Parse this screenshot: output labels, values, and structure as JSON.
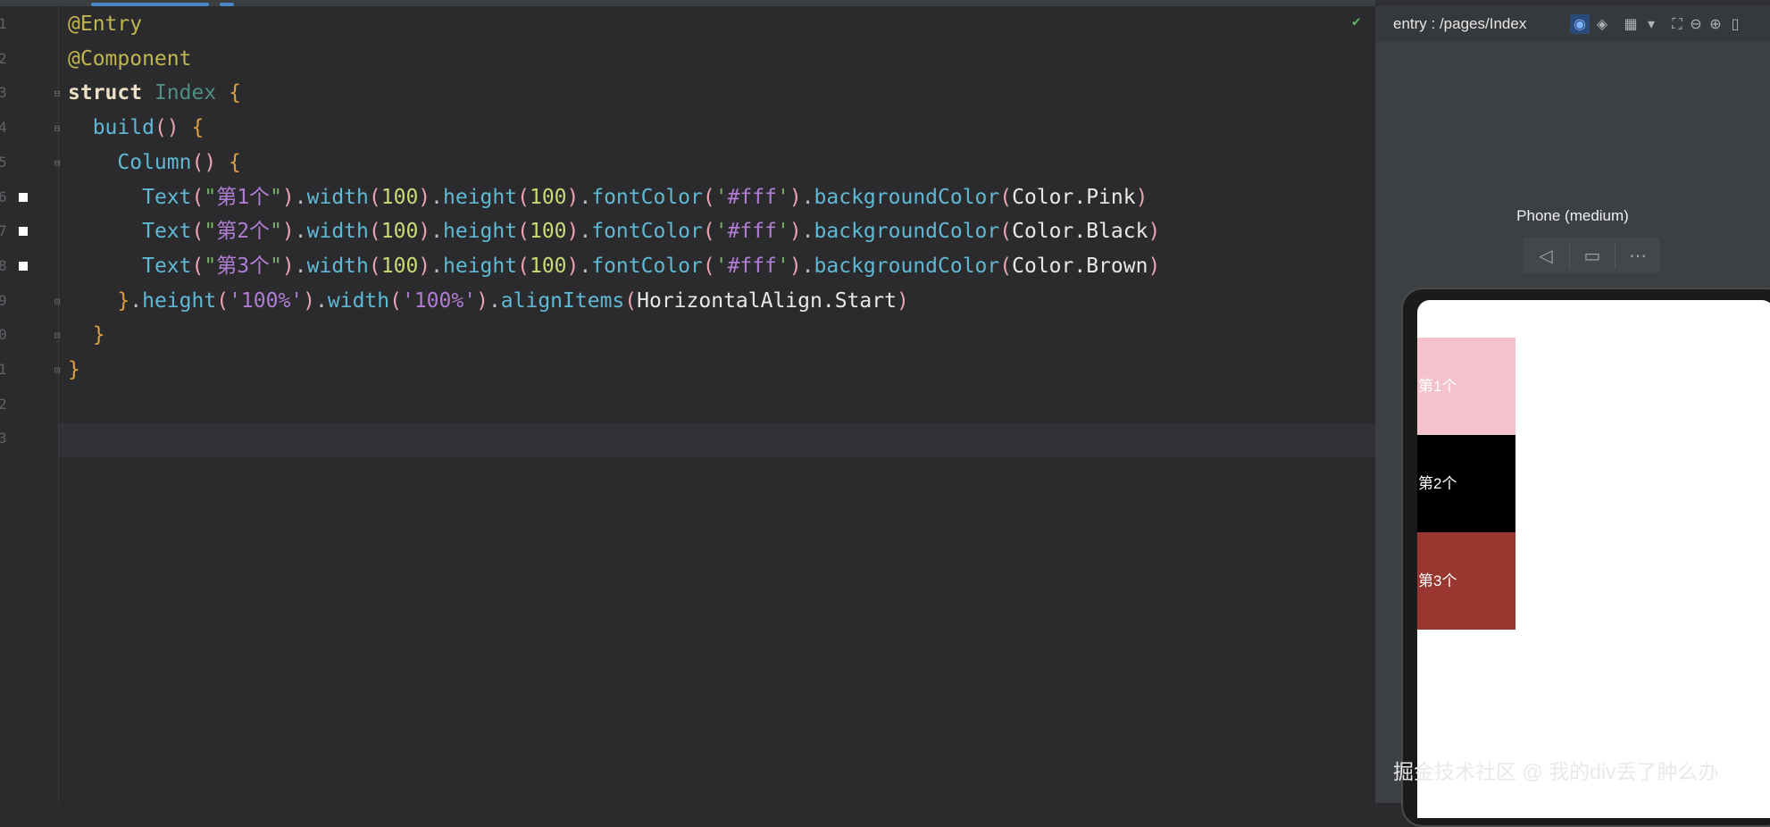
{
  "editor": {
    "line_numbers": [
      "1",
      "2",
      "3",
      "4",
      "5",
      "6",
      "7",
      "8",
      "9",
      "0",
      "1",
      "2",
      "3"
    ],
    "lines": [
      {
        "tokens": [
          {
            "t": "@Entry",
            "c": "dec"
          }
        ]
      },
      {
        "tokens": [
          {
            "t": "@Component",
            "c": "dec"
          }
        ]
      },
      {
        "tokens": [
          {
            "t": "struct",
            "c": "kw"
          },
          {
            "t": " "
          },
          {
            "t": "Index",
            "c": "cls"
          },
          {
            "t": " "
          },
          {
            "t": "{",
            "c": "brace"
          }
        ]
      },
      {
        "tokens": [
          {
            "t": "  "
          },
          {
            "t": "build",
            "c": "fn"
          },
          {
            "t": "()",
            "c": "paren"
          },
          {
            "t": " "
          },
          {
            "t": "{",
            "c": "brace"
          }
        ]
      },
      {
        "tokens": [
          {
            "t": "    "
          },
          {
            "t": "Column",
            "c": "fn"
          },
          {
            "t": "()",
            "c": "paren"
          },
          {
            "t": " "
          },
          {
            "t": "{",
            "c": "brace"
          }
        ]
      },
      {
        "tokens": [
          {
            "t": "      "
          },
          {
            "t": "Text",
            "c": "fn"
          },
          {
            "t": "(",
            "c": "paren"
          },
          {
            "t": "\"",
            "c": "str"
          },
          {
            "t": "第1个",
            "c": "q"
          },
          {
            "t": "\"",
            "c": "str"
          },
          {
            "t": ")",
            "c": "paren"
          },
          {
            "t": ".",
            "c": "punc"
          },
          {
            "t": "width",
            "c": "fn"
          },
          {
            "t": "(",
            "c": "paren"
          },
          {
            "t": "100",
            "c": "num"
          },
          {
            "t": ")",
            "c": "paren"
          },
          {
            "t": ".",
            "c": "punc"
          },
          {
            "t": "height",
            "c": "fn"
          },
          {
            "t": "(",
            "c": "paren"
          },
          {
            "t": "100",
            "c": "num"
          },
          {
            "t": ")",
            "c": "paren"
          },
          {
            "t": ".",
            "c": "punc"
          },
          {
            "t": "fontColor",
            "c": "fn"
          },
          {
            "t": "(",
            "c": "paren"
          },
          {
            "t": "'",
            "c": "str"
          },
          {
            "t": "#fff",
            "c": "q"
          },
          {
            "t": "'",
            "c": "str"
          },
          {
            "t": ")",
            "c": "paren"
          },
          {
            "t": ".",
            "c": "punc"
          },
          {
            "t": "backgroundColor",
            "c": "fn"
          },
          {
            "t": "(",
            "c": "paren"
          },
          {
            "t": "Color.Pink",
            "c": "id"
          },
          {
            "t": ")",
            "c": "paren"
          }
        ]
      },
      {
        "tokens": [
          {
            "t": "      "
          },
          {
            "t": "Text",
            "c": "fn"
          },
          {
            "t": "(",
            "c": "paren"
          },
          {
            "t": "\"",
            "c": "str"
          },
          {
            "t": "第2个",
            "c": "q"
          },
          {
            "t": "\"",
            "c": "str"
          },
          {
            "t": ")",
            "c": "paren"
          },
          {
            "t": ".",
            "c": "punc"
          },
          {
            "t": "width",
            "c": "fn"
          },
          {
            "t": "(",
            "c": "paren"
          },
          {
            "t": "100",
            "c": "num"
          },
          {
            "t": ")",
            "c": "paren"
          },
          {
            "t": ".",
            "c": "punc"
          },
          {
            "t": "height",
            "c": "fn"
          },
          {
            "t": "(",
            "c": "paren"
          },
          {
            "t": "100",
            "c": "num"
          },
          {
            "t": ")",
            "c": "paren"
          },
          {
            "t": ".",
            "c": "punc"
          },
          {
            "t": "fontColor",
            "c": "fn"
          },
          {
            "t": "(",
            "c": "paren"
          },
          {
            "t": "'",
            "c": "str"
          },
          {
            "t": "#fff",
            "c": "q"
          },
          {
            "t": "'",
            "c": "str"
          },
          {
            "t": ")",
            "c": "paren"
          },
          {
            "t": ".",
            "c": "punc"
          },
          {
            "t": "backgroundColor",
            "c": "fn"
          },
          {
            "t": "(",
            "c": "paren"
          },
          {
            "t": "Color.Black",
            "c": "id"
          },
          {
            "t": ")",
            "c": "paren"
          }
        ]
      },
      {
        "tokens": [
          {
            "t": "      "
          },
          {
            "t": "Text",
            "c": "fn"
          },
          {
            "t": "(",
            "c": "paren"
          },
          {
            "t": "\"",
            "c": "str"
          },
          {
            "t": "第3个",
            "c": "q"
          },
          {
            "t": "\"",
            "c": "str"
          },
          {
            "t": ")",
            "c": "paren"
          },
          {
            "t": ".",
            "c": "punc"
          },
          {
            "t": "width",
            "c": "fn"
          },
          {
            "t": "(",
            "c": "paren"
          },
          {
            "t": "100",
            "c": "num"
          },
          {
            "t": ")",
            "c": "paren"
          },
          {
            "t": ".",
            "c": "punc"
          },
          {
            "t": "height",
            "c": "fn"
          },
          {
            "t": "(",
            "c": "paren"
          },
          {
            "t": "100",
            "c": "num"
          },
          {
            "t": ")",
            "c": "paren"
          },
          {
            "t": ".",
            "c": "punc"
          },
          {
            "t": "fontColor",
            "c": "fn"
          },
          {
            "t": "(",
            "c": "paren"
          },
          {
            "t": "'",
            "c": "str"
          },
          {
            "t": "#fff",
            "c": "q"
          },
          {
            "t": "'",
            "c": "str"
          },
          {
            "t": ")",
            "c": "paren"
          },
          {
            "t": ".",
            "c": "punc"
          },
          {
            "t": "backgroundColor",
            "c": "fn"
          },
          {
            "t": "(",
            "c": "paren"
          },
          {
            "t": "Color.Brown",
            "c": "id"
          },
          {
            "t": ")",
            "c": "paren"
          }
        ]
      },
      {
        "tokens": [
          {
            "t": "    "
          },
          {
            "t": "}",
            "c": "brace"
          },
          {
            "t": ".",
            "c": "punc"
          },
          {
            "t": "height",
            "c": "fn"
          },
          {
            "t": "(",
            "c": "paren"
          },
          {
            "t": "'100%'",
            "c": "q"
          },
          {
            "t": ")",
            "c": "paren"
          },
          {
            "t": ".",
            "c": "punc"
          },
          {
            "t": "width",
            "c": "fn"
          },
          {
            "t": "(",
            "c": "paren"
          },
          {
            "t": "'100%'",
            "c": "q"
          },
          {
            "t": ")",
            "c": "paren"
          },
          {
            "t": ".",
            "c": "punc"
          },
          {
            "t": "alignItems",
            "c": "fn"
          },
          {
            "t": "(",
            "c": "paren"
          },
          {
            "t": "HorizontalAlign.Start",
            "c": "id"
          },
          {
            "t": ")",
            "c": "paren"
          }
        ]
      },
      {
        "tokens": [
          {
            "t": "  "
          },
          {
            "t": "}",
            "c": "brace"
          }
        ]
      },
      {
        "tokens": [
          {
            "t": "}",
            "c": "brace"
          }
        ]
      },
      {
        "tokens": []
      },
      {
        "tokens": []
      }
    ],
    "check_mark": "✔"
  },
  "preview": {
    "route": "entry : /pages/Index",
    "device_label": "Phone (medium)",
    "blocks": [
      {
        "text": "第1个",
        "color": "#f4c2cc"
      },
      {
        "text": "第2个",
        "color": "#000000"
      },
      {
        "text": "第3个",
        "color": "#99362f"
      }
    ]
  },
  "watermark": "掘金技术社区 @ 我的div丢了肿么办"
}
